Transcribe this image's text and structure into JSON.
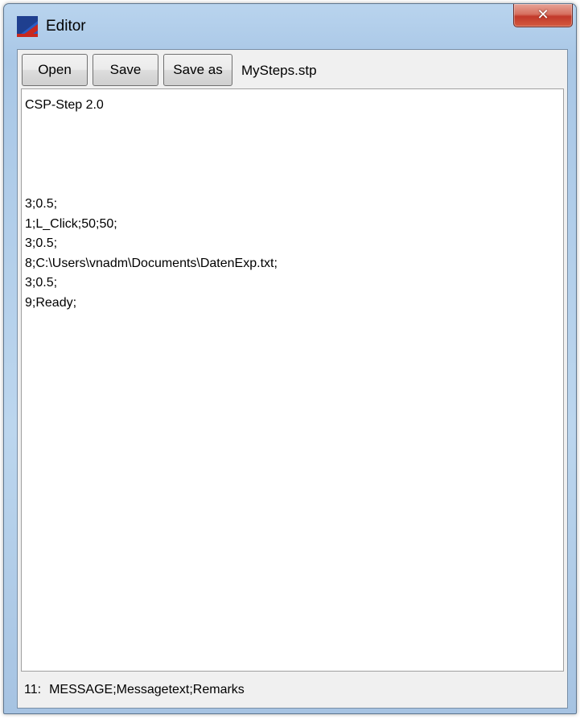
{
  "window": {
    "title": "Editor",
    "close_glyph": "✕",
    "icon": "app-logo-icon",
    "close_icon": "close-icon"
  },
  "toolbar": {
    "open_label": "Open",
    "save_label": "Save",
    "save_as_label": "Save as",
    "filename": "MySteps.stp"
  },
  "editor": {
    "lines": [
      "CSP-Step 2.0",
      "",
      "",
      "",
      "",
      "3;0.5;",
      "1;L_Click;50;50;",
      "3;0.5;",
      "8;C:\\Users\\vnadm\\Documents\\DatenExp.txt;",
      "3;0.5;",
      "9;Ready;"
    ]
  },
  "status": {
    "line_number": "11:",
    "text": "MESSAGE;Messagetext;Remarks"
  },
  "colors": {
    "titlebar": "#b9d4ee",
    "close_button": "#c2392a",
    "logo_blue": "#1f3f8f",
    "logo_red": "#c8281e"
  }
}
